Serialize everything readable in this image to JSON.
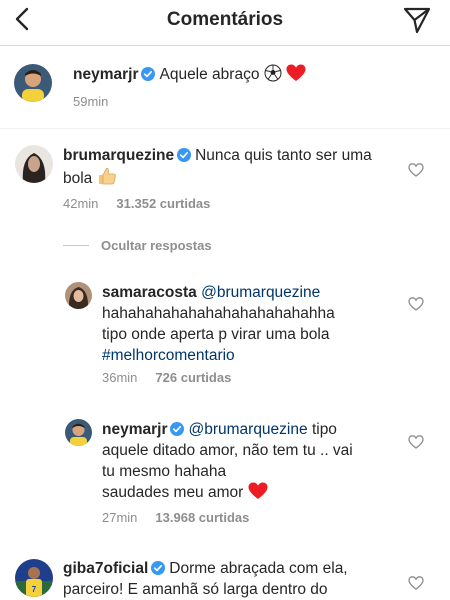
{
  "header": {
    "title": "Comentários"
  },
  "post": {
    "username": "neymarjr",
    "caption_text": "Aquele abraço",
    "time": "59min"
  },
  "comments": [
    {
      "username": "brumarquezine",
      "text": "Nunca quis tanto ser uma bola",
      "time": "42min",
      "likes": "31.352 curtidas"
    },
    {
      "username": "giba7oficial",
      "text": "Dorme abraçada com ela, parceiro! E amanhã só larga dentro do"
    }
  ],
  "replies_toggle": "Ocultar respostas",
  "replies": [
    {
      "username": "samaracosta",
      "mention": "@brumarquezine",
      "line1": "hahahahahahahahahahahahahha",
      "line2": "tipo onde aperta p virar uma bola",
      "hashtag": "#melhorcomentario",
      "time": "36min",
      "likes": "726 curtidas"
    },
    {
      "username": "neymarjr",
      "mention": "@brumarquezine",
      "line1_rest": "tipo",
      "line2": "aquele ditado amor, não tem tu .. vai",
      "line3": "tu mesmo hahaha",
      "line4": "saudades meu amor",
      "time": "27min",
      "likes": "13.968 curtidas"
    }
  ],
  "colors": {
    "verified": "#3897f0",
    "heart_red": "#ed4956",
    "mention": "#003569",
    "meta_gray": "#8e8e8e"
  }
}
